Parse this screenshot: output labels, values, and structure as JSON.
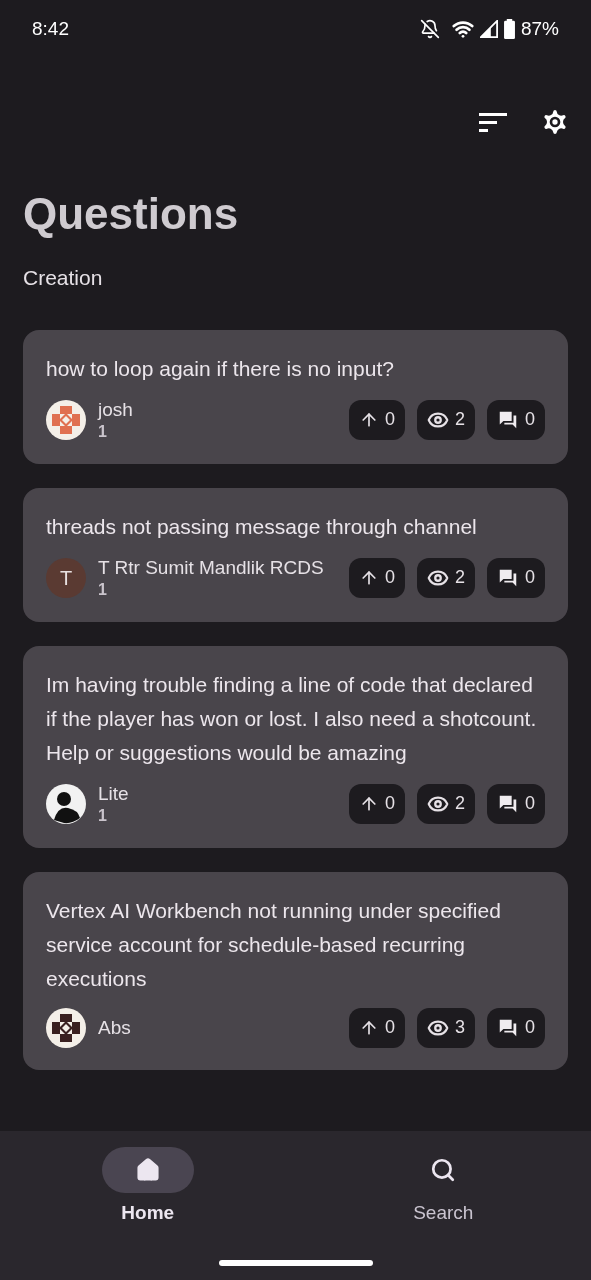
{
  "status_bar": {
    "time": "8:42",
    "battery": "87%"
  },
  "header": {
    "title": "Questions",
    "subtitle": "Creation"
  },
  "questions": [
    {
      "title": "how to loop again if there is no input?",
      "author": "josh",
      "reputation": "1",
      "avatar": {
        "kind": "pattern",
        "color": "#e07050"
      },
      "upvotes": "0",
      "views": "2",
      "answers": "0"
    },
    {
      "title": "threads not passing message through channel",
      "author": "T Rtr Sumit Mandlik RCDS",
      "reputation": "1",
      "avatar": {
        "kind": "letter",
        "letter": "T",
        "color": "#5a3a32"
      },
      "upvotes": "0",
      "views": "2",
      "answers": "0"
    },
    {
      "title": "Im having trouble finding a line of code that declared if the player has won or lost. I also need a shotcount. Help or suggestions would be amazing",
      "author": "Lite",
      "reputation": "1",
      "avatar": {
        "kind": "photo",
        "color": "#111111"
      },
      "upvotes": "0",
      "views": "2",
      "answers": "0"
    },
    {
      "title": "Vertex AI Workbench not running under specified service account for schedule-based recurring executions",
      "author": "Abs",
      "avatar": {
        "kind": "pattern",
        "color": "#3a2020"
      },
      "upvotes": "0",
      "views": "3",
      "answers": "0"
    }
  ],
  "nav": [
    {
      "label": "Home",
      "kind": "home",
      "selected": true
    },
    {
      "label": "Search",
      "kind": "search",
      "selected": false
    }
  ]
}
